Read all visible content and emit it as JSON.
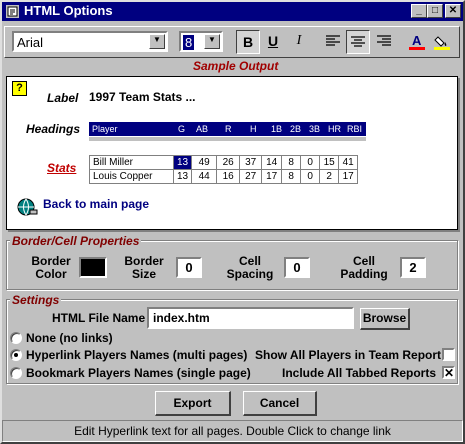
{
  "window": {
    "title": "HTML Options"
  },
  "toolbar": {
    "font_value": "Arial",
    "size_value": "8",
    "bold_label": "B",
    "underline_label": "U",
    "italic_label": "I"
  },
  "sample": {
    "title": "Sample Output",
    "label_caption": "Label",
    "label_value": "1997 Team Stats ...",
    "headings_caption": "Headings",
    "stats_caption": "Stats",
    "columns": [
      "Player",
      "G",
      "AB",
      "R",
      "H",
      "1B",
      "2B",
      "3B",
      "HR",
      "RBI"
    ],
    "rows": [
      [
        "Bill Miller",
        "13",
        "49",
        "26",
        "37",
        "14",
        "8",
        "0",
        "15",
        "41"
      ],
      [
        "Louis Copper",
        "13",
        "44",
        "16",
        "27",
        "17",
        "8",
        "0",
        "2",
        "17"
      ]
    ],
    "back_link": "Back to main page"
  },
  "border": {
    "title": "Border/Cell Properties",
    "border_color_label": "Border Color",
    "border_color": "#000000",
    "border_size_label": "Border Size",
    "border_size": "0",
    "cell_spacing_label": "Cell Spacing",
    "cell_spacing": "0",
    "cell_padding_label": "Cell Padding",
    "cell_padding": "2"
  },
  "settings": {
    "title": "Settings",
    "file_name_label": "HTML File Name",
    "file_name": "index.htm",
    "browse_label": "Browse",
    "radio_none": "None (no links)",
    "radio_hyperlink": "Hyperlink Players Names (multi pages)",
    "radio_bookmark": "Bookmark Players Names (single page)",
    "check_all_players": "Show All Players in Team Report",
    "check_all_tabbed": "Include All Tabbed Reports"
  },
  "buttons": {
    "export": "Export",
    "cancel": "Cancel"
  },
  "status": "Edit Hyperlink text for all pages.  Double Click to change link",
  "colors": {
    "titlebar": "#000080",
    "accent_red": "#800000",
    "highlight_cell": "#000080"
  }
}
